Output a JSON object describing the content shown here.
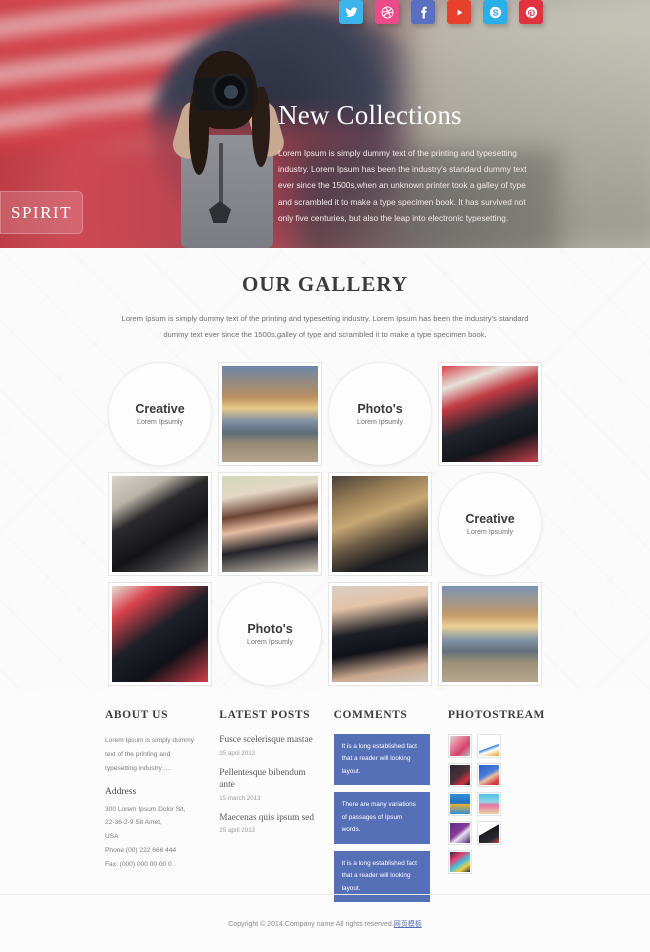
{
  "hero": {
    "logo": "SPIRIT",
    "title": "New Collections",
    "paragraph": "Lorem Ipsum is simply dummy text of the printing and typesetting industry. Lorem Ipsum has been the industry's standard dummy text ever since the 1500s,when an unknown printer took a galley of type and scrambled it to make a type specimen book. It has survived not only five centuries, but also the leap into electronic typesetting.",
    "social": [
      {
        "name": "twitter",
        "glyph": "twitter",
        "color": "#3ab4ea"
      },
      {
        "name": "dribbble",
        "glyph": "dribbble",
        "color": "#ec4a89"
      },
      {
        "name": "facebook",
        "glyph": "facebook",
        "color": "#5a6fc0"
      },
      {
        "name": "youtube",
        "glyph": "youtube",
        "color": "#e8412e"
      },
      {
        "name": "skype",
        "glyph": "skype",
        "color": "#2ab0e8"
      },
      {
        "name": "pinterest",
        "glyph": "pinterest",
        "color": "#e0333f"
      }
    ]
  },
  "gallery": {
    "heading": "OUR GALLERY",
    "subtext": "Lorem Ipsum is simply dummy text of the printing and typesetting industry. Lorem Ipsum has been the industry's standard dummy text ever since the 1500s,galley of type and scrambled it to make a type specimen book.",
    "items": [
      {
        "kind": "circle",
        "title": "Creative",
        "sub": "Lorem Ipsumly"
      },
      {
        "kind": "photo",
        "alt": "photographer-on-mountain",
        "style": "p-mountain"
      },
      {
        "kind": "circle",
        "title": "Photo's",
        "sub": "Lorem Ipsumly"
      },
      {
        "kind": "photo",
        "alt": "hand-holding-camera-red-shirt",
        "style": "p-redcam"
      },
      {
        "kind": "photo",
        "alt": "nikon-dslr-closeup",
        "style": "p-nikon"
      },
      {
        "kind": "photo",
        "alt": "woman-with-camera-smiling",
        "style": "p-girl"
      },
      {
        "kind": "photo",
        "alt": "cat-behind-camera",
        "style": "p-cat"
      },
      {
        "kind": "circle",
        "title": "Creative",
        "sub": "Lorem Ipsumly"
      },
      {
        "kind": "photo",
        "alt": "hand-holding-camera-red-shirt",
        "style": "p-redcam2"
      },
      {
        "kind": "circle",
        "title": "Photo's",
        "sub": "Lorem Ipsumly"
      },
      {
        "kind": "photo",
        "alt": "woman-shooting-camera",
        "style": "p-girl2"
      },
      {
        "kind": "photo",
        "alt": "photographer-on-mountain",
        "style": "p-mountain2"
      }
    ]
  },
  "footer": {
    "about": {
      "heading": "ABOUT US",
      "text": "Lorem Ipsum is simply dummy text of the printing and typesetting industry ....",
      "address_heading": "Address",
      "address_lines": [
        "300 Lorem Ipsum Dolor Sit,",
        "22-36-2-9 Sit Amet,",
        "USA",
        "Phone:(00) 222 666 444",
        "Fax: (000) 000 00 00 0"
      ]
    },
    "posts": {
      "heading": "LATEST POSTS",
      "items": [
        {
          "title": "Fusce scelerisque mastae",
          "date": "25 april 2013"
        },
        {
          "title": "Pellentesque bibendum ante",
          "date": "15 march 2013"
        },
        {
          "title": "Maecenas quis ipsum sed",
          "date": "25 april 2013"
        }
      ]
    },
    "comments": {
      "heading": "COMMENTS",
      "items": [
        "It is a long established fact that a reader will looking layout.",
        "There are many variations of passages of Ipsum words.",
        "It is a long established fact that a reader will looking layout."
      ]
    },
    "photostream": {
      "heading": "PHOTOSTREAM",
      "thumbs": [
        {
          "alt": "pink-heart-thumbnail",
          "style": "t1"
        },
        {
          "alt": "accurus-logo-thumbnail",
          "style": "t2"
        },
        {
          "alt": "dark-scene-thumbnail",
          "style": "t3"
        },
        {
          "alt": "character-illustration-thumbnail",
          "style": "t4"
        },
        {
          "alt": "flat-ui-thumbnail",
          "style": "t5"
        },
        {
          "alt": "beach-illustration-thumbnail",
          "style": "t6"
        },
        {
          "alt": "hello-purple-thumbnail",
          "style": "t7"
        },
        {
          "alt": "black-cat-thumbnail",
          "style": "t8"
        },
        {
          "alt": "colorful-icons-thumbnail",
          "style": "t9"
        }
      ]
    }
  },
  "copyright": {
    "text": "Copyright © 2014.Company name All rights reserved.",
    "link": "网页模板"
  }
}
